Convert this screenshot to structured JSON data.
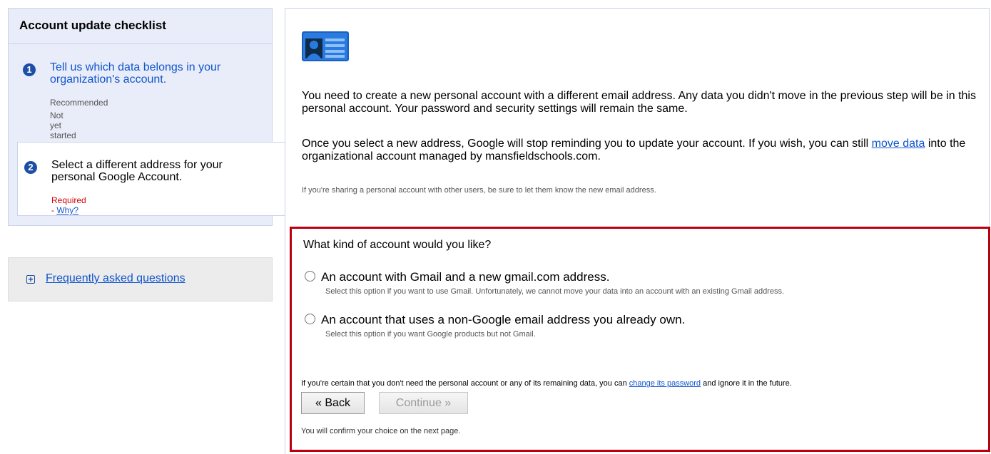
{
  "sidebar": {
    "title": "Account update checklist",
    "steps": [
      {
        "number": "1",
        "title": "Tell us which data belongs in your organization's account.",
        "priority": "Recommended",
        "status": "Not yet started"
      },
      {
        "number": "2",
        "title": "Select a different address for your personal Google Account.",
        "priority": "Required",
        "separator": " - ",
        "why_link": "Why?"
      }
    ],
    "faq": {
      "icon": "plus-box-icon",
      "label": "Frequently asked questions"
    }
  },
  "main": {
    "icon": "id-card-icon",
    "paragraph1": "You need to create a new personal account with a different email address. Any data you didn't move in the previous step will be in this personal account. Your password and security settings will remain the same.",
    "paragraph2_before": "Once you select a new address, Google will stop reminding you to update your account. If you wish, you can still ",
    "paragraph2_link": "move data",
    "paragraph2_after": " into the organizational account managed by mansfieldschools.com.",
    "note": "If you're sharing a personal account with other users, be sure to let them know the new email address."
  },
  "choice": {
    "question": "What kind of account would you like?",
    "options": [
      {
        "label": "An account with Gmail and a new gmail.com address.",
        "help": "Select this option if you want to use Gmail. Unfortunately, we cannot move your data into an account with an existing Gmail address."
      },
      {
        "label": "An account that uses a non-Google email address you already own.",
        "help": "Select this option if you want Google products but not Gmail."
      }
    ],
    "certain_before": "If you're certain that you don't need the personal account or any of its remaining data, you can ",
    "certain_link": "change its password",
    "certain_after": " and ignore it in the future.",
    "back_label": "« Back",
    "continue_label": "Continue »",
    "confirm_note": "You will confirm your choice on the next page."
  },
  "colors": {
    "accent": "#1155cc",
    "step_badge": "#1e4fa6",
    "required": "#d10000",
    "highlight_border": "#b8000f",
    "sidebar_bg": "#e9edf9"
  }
}
